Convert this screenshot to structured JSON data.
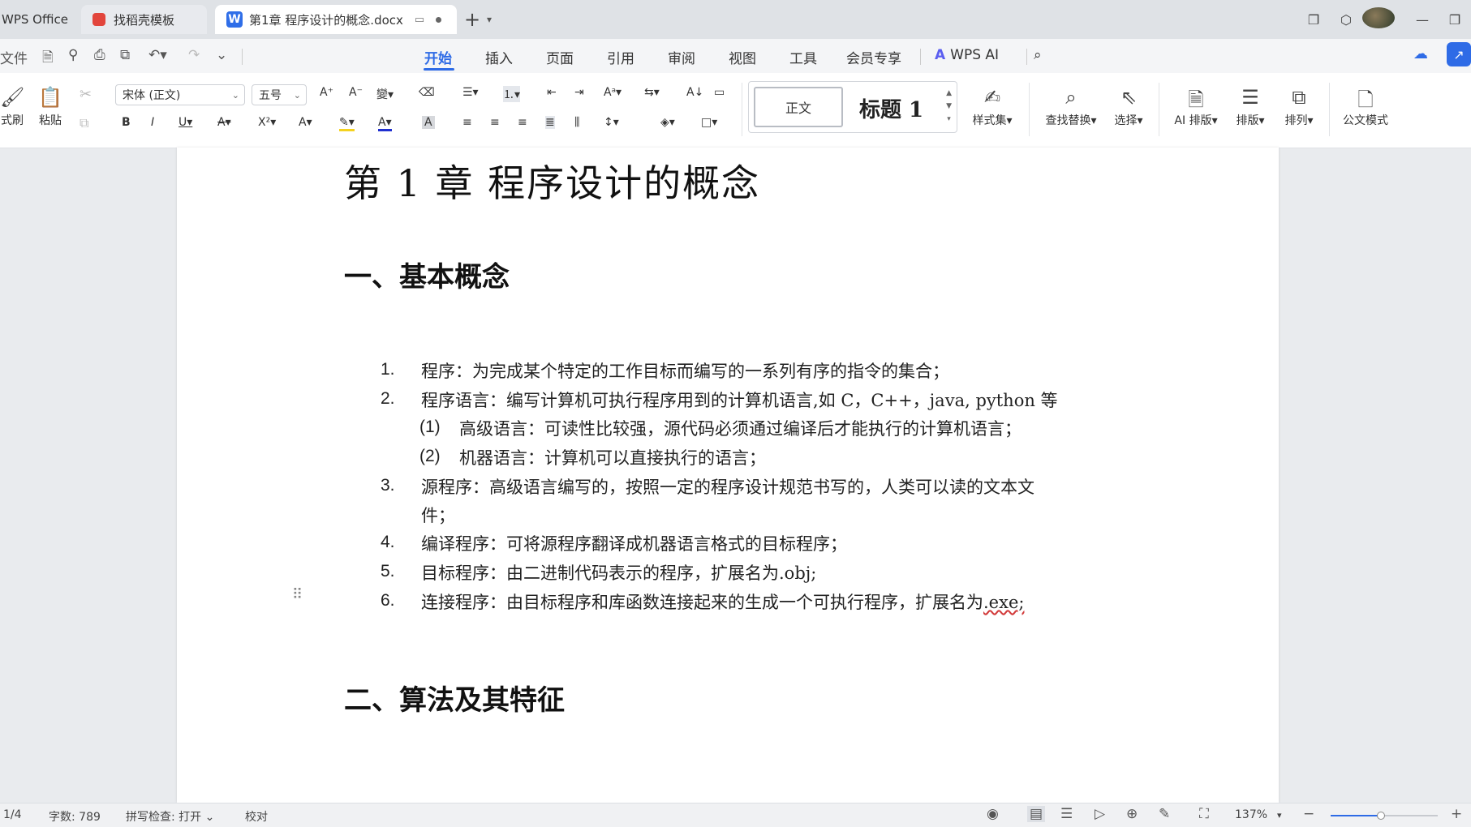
{
  "tabs": {
    "app": "WPS Office",
    "docer": "找稻壳模板",
    "document": "第1章 程序设计的概念.docx"
  },
  "menu": {
    "file": "文件",
    "items": [
      "开始",
      "插入",
      "页面",
      "引用",
      "审阅",
      "视图",
      "工具",
      "会员专享"
    ],
    "active": "开始",
    "ai": "WPS AI"
  },
  "ribbon": {
    "format_painter": "式刷",
    "paste": "粘贴",
    "font_name": "宋体 (正文)",
    "font_size": "五号",
    "style_normal": "正文",
    "style_heading": "标题 1",
    "style_set": "样式集",
    "find_replace": "查找替换",
    "select": "选择",
    "ai_layout": "AI 排版",
    "layout": "排版",
    "arrange": "排列",
    "official_mode": "公文模式"
  },
  "document": {
    "title": "第 1 章  程序设计的概念",
    "section1": "一、基本概念",
    "items": [
      {
        "num": "1.",
        "text": "程序：为完成某个特定的工作目标而编写的一系列有序的指令的集合；"
      },
      {
        "num": "2.",
        "text": "程序语言：编写计算机可执行程序用到的计算机语言,如 C，C++，java, python 等"
      },
      {
        "num": "(1)",
        "text": "高级语言：可读性比较强，源代码必须通过编译后才能执行的计算机语言；"
      },
      {
        "num": "(2)",
        "text": "机器语言：计算机可以直接执行的语言；"
      },
      {
        "num": "3.",
        "text": "源程序：高级语言编写的，按照一定的程序设计规范书写的，人类可以读的文本文"
      },
      {
        "num": "",
        "text": "件；"
      },
      {
        "num": "4.",
        "text": "编译程序：可将源程序翻译成机器语言格式的目标程序；"
      },
      {
        "num": "5.",
        "text": "目标程序：由二进制代码表示的程序，扩展名为.obj;"
      },
      {
        "num": "6.",
        "text_main": "连接程序：由目标程序和库函数连接起来的生成一个可执行程序，扩展名为",
        "text_marked": ".exe;"
      }
    ],
    "section2": "二、算法及其特征"
  },
  "status": {
    "page": "1/4",
    "word_count": "字数: 789",
    "spell_check": "拼写检查: 打开",
    "proofread": "校对",
    "zoom": "137%",
    "zoom_level_fraction": 0.47
  }
}
